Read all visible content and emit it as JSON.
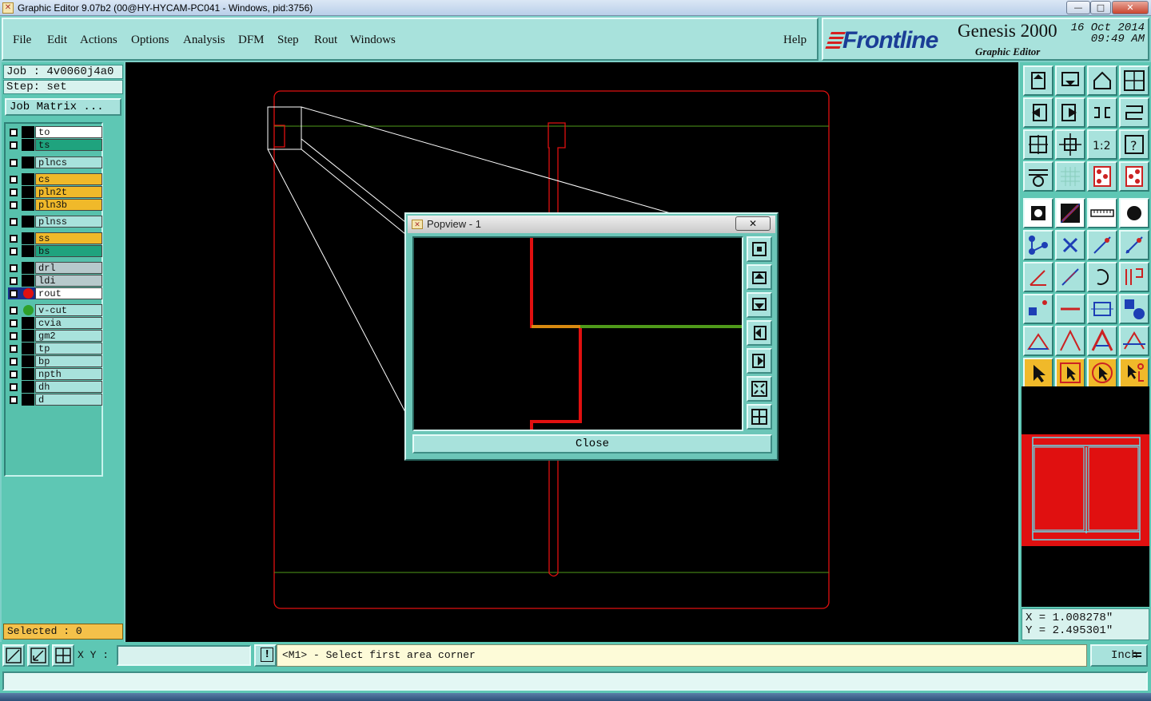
{
  "window": {
    "title": "Graphic Editor 9.07b2 (00@HY-HYCAM-PC041 - Windows, pid:3756)",
    "minimize": "—",
    "maximize": "□",
    "close": "✕"
  },
  "menu": {
    "items": [
      "File",
      "Edit",
      "Actions",
      "Options",
      "Analysis",
      "DFM",
      "Step",
      "Rout",
      "Windows"
    ],
    "help": "Help"
  },
  "brand": {
    "logo": "Frontline",
    "product": "Genesis 2000",
    "subtitle": "Graphic Editor",
    "date": "16 Oct 2014",
    "time": "09:49 AM"
  },
  "job": {
    "job_label": "Job : 4v0060j4a0",
    "step_label": "Step: set",
    "matrix_button": "Job Matrix ..."
  },
  "layers": [
    {
      "name": "to",
      "color": "#ffffff",
      "marker": ""
    },
    {
      "name": "ts",
      "color": "#1fa37e",
      "marker": ""
    },
    {
      "name": "plncs",
      "color": "#a8e2dc",
      "marker": ""
    },
    {
      "name": "cs",
      "color": "#f0b92a",
      "marker": ""
    },
    {
      "name": "pln2t",
      "color": "#f0b92a",
      "marker": ""
    },
    {
      "name": "pln3b",
      "color": "#f0b92a",
      "marker": ""
    },
    {
      "name": "plnss",
      "color": "#a8e2dc",
      "marker": ""
    },
    {
      "name": "ss",
      "color": "#f0b92a",
      "marker": ""
    },
    {
      "name": "bs",
      "color": "#1fa37e",
      "marker": ""
    },
    {
      "name": "drl",
      "color": "#b7c9cc",
      "marker": ""
    },
    {
      "name": "ldi",
      "color": "#b7c9cc",
      "marker": ""
    },
    {
      "name": "rout",
      "color": "#ffffff",
      "marker": "red"
    },
    {
      "name": "v-cut",
      "color": "#a8e2dc",
      "marker": "green"
    },
    {
      "name": "cvia",
      "color": "#a8e2dc",
      "marker": ""
    },
    {
      "name": "gm2",
      "color": "#a8e2dc",
      "marker": ""
    },
    {
      "name": "tp",
      "color": "#a8e2dc",
      "marker": ""
    },
    {
      "name": "bp",
      "color": "#a8e2dc",
      "marker": ""
    },
    {
      "name": "npth",
      "color": "#a8e2dc",
      "marker": ""
    },
    {
      "name": "dh",
      "color": "#a8e2dc",
      "marker": ""
    },
    {
      "name": "d",
      "color": "#a8e2dc",
      "marker": ""
    }
  ],
  "selected": "Selected : 0",
  "popview": {
    "title": "Popview - 1",
    "close_x": "✕",
    "close_button": "Close"
  },
  "coords": {
    "x": "X = 1.008278\"",
    "y": "Y = 2.495301\""
  },
  "bottom": {
    "xy_label": "X Y :",
    "xy_value": "",
    "warn": "!",
    "prompt": "<M1> - Select first area corner",
    "units": "Inch"
  },
  "colors": {
    "rout": "#e01010",
    "vcut": "#4f9a1a",
    "panel": "#5ec7b4",
    "button": "#a8e2dc"
  }
}
